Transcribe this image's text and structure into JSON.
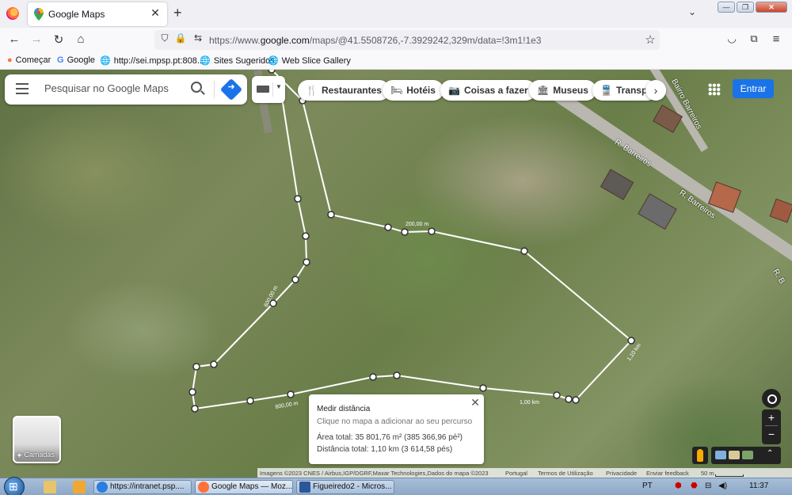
{
  "browser": {
    "tab_title": "Google Maps",
    "new_tab": "+",
    "close_tab": "✕",
    "url_prefix": "https://www.",
    "url_domain": "google.com",
    "url_rest": "/maps/@41.5508726,-7.3929242,329m/data=!3m1!1e3",
    "window_min": "—",
    "window_max": "❐",
    "window_close": "✕",
    "bookmarks": [
      {
        "label": "Começar",
        "icon": "firefox-icon"
      },
      {
        "label": "Google",
        "icon": "google-icon"
      },
      {
        "label": "http://sei.mpsp.pt:808...",
        "icon": "globe-icon"
      },
      {
        "label": "Sites Sugeridos",
        "icon": "globe-icon"
      },
      {
        "label": "Web Slice Gallery",
        "icon": "globe-icon"
      }
    ]
  },
  "maps": {
    "search_placeholder": "Pesquisar no Google Maps",
    "chips": [
      {
        "label": "Restaurantes",
        "icon": "restaurant-icon"
      },
      {
        "label": "Hotéis",
        "icon": "hotel-icon"
      },
      {
        "label": "Coisas a fazer",
        "icon": "camera-icon"
      },
      {
        "label": "Museus",
        "icon": "museum-icon"
      },
      {
        "label": "Transpo",
        "icon": "transit-icon"
      }
    ],
    "chip_next": "›",
    "signin": "Entrar",
    "road_labels": [
      "R. Barreiros",
      "R. Barreiros",
      "Bairro Barreiros",
      "R. B"
    ],
    "distance_labels": [
      "200,00 m",
      "600,00 m",
      "800,00 m",
      "1,00 km",
      "1,10 km"
    ],
    "measure": {
      "title": "Medir distância",
      "hint": "Clique no mapa a adicionar ao seu percurso",
      "area": "Área total: 35 801,76 m² (385 366,96 pé²)",
      "distance": "Distância total: 1,10 km (3 614,58 pés)",
      "close": "✕"
    },
    "layers_label": "Camadas",
    "zoom_in": "+",
    "zoom_out": "−",
    "attribution": [
      "Imagens ©2023 CNES / Airbus,IGP/DGRF,Maxar Technologies,Dados do mapa ©2023",
      "Portugal",
      "Termos de Utilização",
      "Privacidade",
      "Enviar feedback",
      "50 m"
    ]
  },
  "taskbar": {
    "tasks": [
      {
        "label": "https://intranet.psp....",
        "color": "#2a7de1"
      },
      {
        "label": "Google Maps — Moz...",
        "color": "#ff7139"
      },
      {
        "label": "Figueiredo2 - Micros...",
        "color": "#2b579a"
      }
    ],
    "lang": "PT",
    "time": "11:37"
  }
}
